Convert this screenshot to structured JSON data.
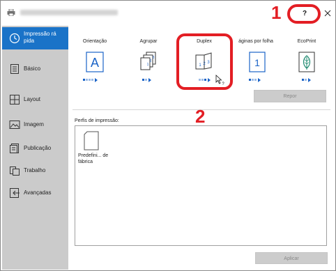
{
  "window": {
    "help_label": "?",
    "annotation_1": "1",
    "annotation_2": "2"
  },
  "sidebar": {
    "items": [
      {
        "label": "Impressão rá pida",
        "icon": "clock-icon",
        "selected": true
      },
      {
        "label": "Básico",
        "icon": "document-lines-icon",
        "selected": false
      },
      {
        "label": "Layout",
        "icon": "grid-layout-icon",
        "selected": false
      },
      {
        "label": "Imagem",
        "icon": "image-icon",
        "selected": false
      },
      {
        "label": "Publicação",
        "icon": "publication-icon",
        "selected": false
      },
      {
        "label": "Trabalho",
        "icon": "job-icon",
        "selected": false
      },
      {
        "label": "Avançadas",
        "icon": "advanced-arrow-icon",
        "selected": false
      }
    ]
  },
  "options": [
    {
      "label": "Orientação",
      "icon": "orientation-a-icon",
      "level": 1
    },
    {
      "label": "Agrupar",
      "icon": "collate-icon",
      "level": 1
    },
    {
      "label": "Duplex",
      "icon": "duplex-icon",
      "level": 3
    },
    {
      "label": "áginas por folha",
      "icon": "pages-per-sheet-icon",
      "level": 1
    },
    {
      "label": "EcoPrint",
      "icon": "ecoprint-leaf-icon",
      "level": 1
    }
  ],
  "buttons": {
    "repor": "Repor",
    "aplicar": "Aplicar"
  },
  "profiles": {
    "label": "Perfis de impressão:",
    "items": [
      {
        "name": "Predefini... de fábrica"
      }
    ]
  },
  "colors": {
    "accent": "#1a73c8",
    "highlight": "#e31e24",
    "sidebar": "#cbcbcb"
  }
}
